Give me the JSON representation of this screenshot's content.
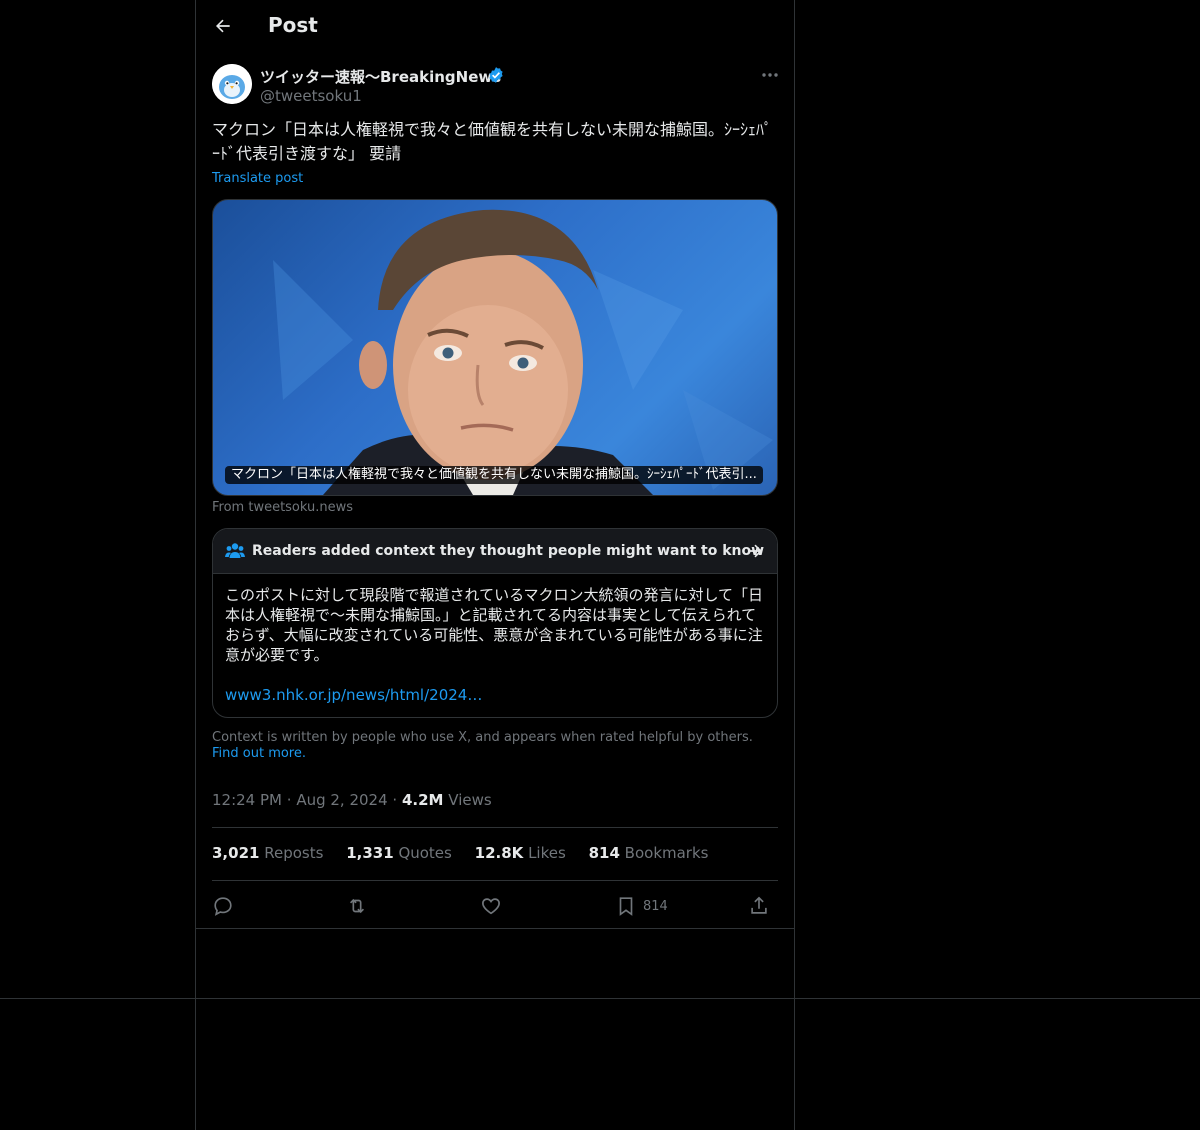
{
  "header": {
    "title": "Post"
  },
  "author": {
    "name": "ツイッター速報〜BreakingNews",
    "handle": "@tweetsoku1"
  },
  "post": {
    "text": "マクロン「日本は人権軽視で我々と価値観を共有しない未開な捕鯨国。ｼｰｼｪﾊﾟｰﾄﾞ代表引き渡すな」 要請",
    "translate_label": "Translate post"
  },
  "card": {
    "caption": "マクロン「日本は人権軽視で我々と価値観を共有しない未開な捕鯨国。ｼｰｼｪﾊﾟｰﾄﾞ代表引...",
    "source": "From tweetsoku.news"
  },
  "community_note": {
    "title": "Readers added context they thought people might want to know",
    "body": "このポストに対して現段階で報道されているマクロン大統領の発言に対して「日本は人権軽視で〜未開な捕鯨国。」と記載されてる内容は事実として伝えられておらず、大幅に改変されている可能性、悪意が含まれている可能性がある事に注意が必要です。",
    "link": "www3.nhk.or.jp/news/html/2024…",
    "footer": "Context is written by people who use X, and appears when rated helpful by others.",
    "find_out": "Find out more."
  },
  "meta": {
    "time": "12:24 PM",
    "dot": "·",
    "date": "Aug 2, 2024",
    "views_count": "4.2M",
    "views_label": "Views"
  },
  "stats": {
    "reposts_count": "3,021",
    "reposts_label": "Reposts",
    "quotes_count": "1,331",
    "quotes_label": "Quotes",
    "likes_count": "12.8K",
    "likes_label": "Likes",
    "bookmarks_count": "814",
    "bookmarks_label": "Bookmarks"
  },
  "actions": {
    "bookmark_count": "814"
  },
  "colors": {
    "accent": "#1d9bf0",
    "background": "#000000",
    "border": "#2f3336",
    "muted_text": "#71767b"
  }
}
